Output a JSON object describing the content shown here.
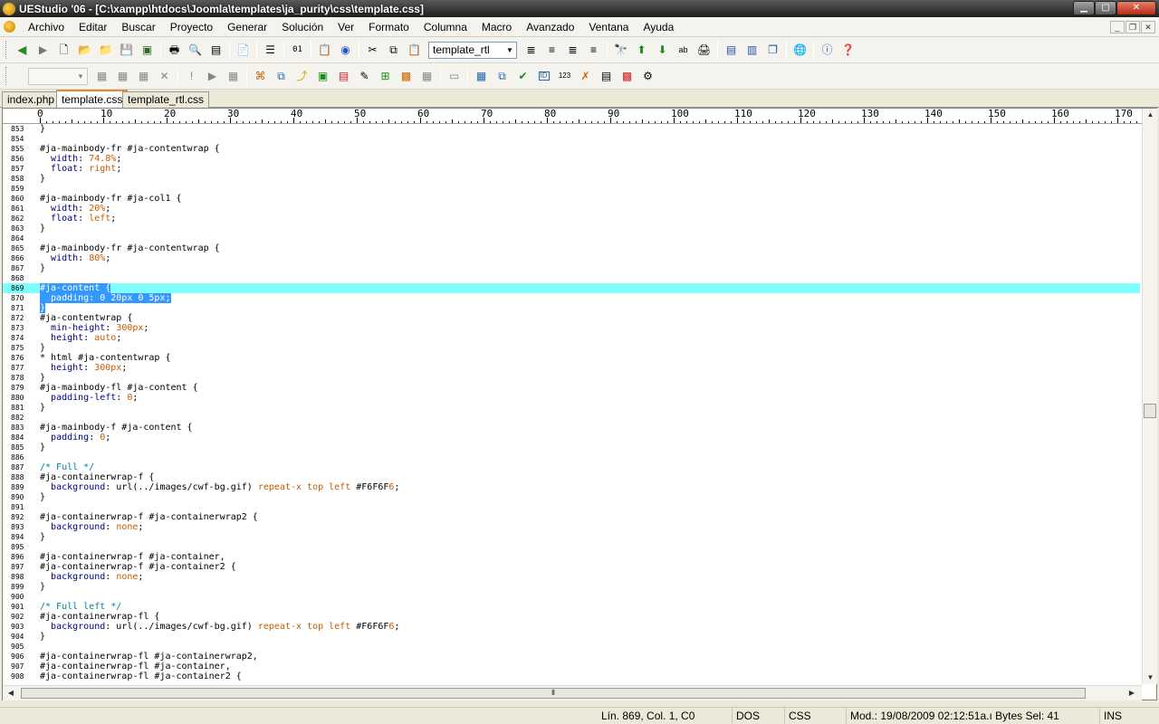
{
  "window": {
    "title": "UEStudio '06 - [C:\\xampp\\htdocs\\Joomla\\templates\\ja_purity\\css\\template.css]"
  },
  "menu": [
    "Archivo",
    "Editar",
    "Buscar",
    "Proyecto",
    "Generar",
    "Solución",
    "Ver",
    "Formato",
    "Columna",
    "Macro",
    "Avanzado",
    "Ventana",
    "Ayuda"
  ],
  "toolbar": {
    "combo_value": "template_rtl"
  },
  "tabs": [
    {
      "label": "index.php"
    },
    {
      "label": "template.css",
      "active": true
    },
    {
      "label": "template_rtl.css"
    }
  ],
  "ruler": [
    "0",
    "10",
    "20",
    "30",
    "40",
    "50",
    "60",
    "70",
    "80",
    "90",
    "100",
    "110",
    "120",
    "130",
    "140",
    "150",
    "160",
    "170"
  ],
  "code_lines": [
    {
      "n": "853",
      "t": "}"
    },
    {
      "n": "854",
      "t": ""
    },
    {
      "n": "855",
      "t": "#ja-mainbody-fr #ja-contentwrap {"
    },
    {
      "n": "856",
      "t": "  width: 74.8%;"
    },
    {
      "n": "857",
      "t": "  float: right;"
    },
    {
      "n": "858",
      "t": "}"
    },
    {
      "n": "859",
      "t": ""
    },
    {
      "n": "860",
      "t": "#ja-mainbody-fr #ja-col1 {"
    },
    {
      "n": "861",
      "t": "  width: 20%;"
    },
    {
      "n": "862",
      "t": "  float: left;"
    },
    {
      "n": "863",
      "t": "}"
    },
    {
      "n": "864",
      "t": ""
    },
    {
      "n": "865",
      "t": "#ja-mainbody-fr #ja-contentwrap {"
    },
    {
      "n": "866",
      "t": "  width: 80%;"
    },
    {
      "n": "867",
      "t": "}"
    },
    {
      "n": "868",
      "t": ""
    },
    {
      "n": "869",
      "t": "#ja-content {",
      "sel": true,
      "hl": true
    },
    {
      "n": "870",
      "t": "  padding: 0 20px 0 5px;",
      "sel": true
    },
    {
      "n": "871",
      "t": "}",
      "sel": true
    },
    {
      "n": "872",
      "t": "#ja-contentwrap {"
    },
    {
      "n": "873",
      "t": "  min-height: 300px;"
    },
    {
      "n": "874",
      "t": "  height: auto;"
    },
    {
      "n": "875",
      "t": "}"
    },
    {
      "n": "876",
      "t": "* html #ja-contentwrap {"
    },
    {
      "n": "877",
      "t": "  height: 300px;"
    },
    {
      "n": "878",
      "t": "}"
    },
    {
      "n": "879",
      "t": "#ja-mainbody-fl #ja-content {"
    },
    {
      "n": "880",
      "t": "  padding-left: 0;"
    },
    {
      "n": "881",
      "t": "}"
    },
    {
      "n": "882",
      "t": ""
    },
    {
      "n": "883",
      "t": "#ja-mainbody-f #ja-content {"
    },
    {
      "n": "884",
      "t": "  padding: 0;"
    },
    {
      "n": "885",
      "t": "}"
    },
    {
      "n": "886",
      "t": ""
    },
    {
      "n": "887",
      "t": "/* Full */"
    },
    {
      "n": "888",
      "t": "#ja-containerwrap-f {"
    },
    {
      "n": "889",
      "t": "  background: url(../images/cwf-bg.gif) repeat-x top left #F6F6F6;"
    },
    {
      "n": "890",
      "t": "}"
    },
    {
      "n": "891",
      "t": ""
    },
    {
      "n": "892",
      "t": "#ja-containerwrap-f #ja-containerwrap2 {"
    },
    {
      "n": "893",
      "t": "  background: none;"
    },
    {
      "n": "894",
      "t": "}"
    },
    {
      "n": "895",
      "t": ""
    },
    {
      "n": "896",
      "t": "#ja-containerwrap-f #ja-container,"
    },
    {
      "n": "897",
      "t": "#ja-containerwrap-f #ja-container2 {"
    },
    {
      "n": "898",
      "t": "  background: none;"
    },
    {
      "n": "899",
      "t": "}"
    },
    {
      "n": "900",
      "t": ""
    },
    {
      "n": "901",
      "t": "/* Full left */"
    },
    {
      "n": "902",
      "t": "#ja-containerwrap-fl {"
    },
    {
      "n": "903",
      "t": "  background: url(../images/cwf-bg.gif) repeat-x top left #F6F6F6;"
    },
    {
      "n": "904",
      "t": "}"
    },
    {
      "n": "905",
      "t": ""
    },
    {
      "n": "906",
      "t": "#ja-containerwrap-fl #ja-containerwrap2,"
    },
    {
      "n": "907",
      "t": "#ja-containerwrap-fl #ja-container,"
    },
    {
      "n": "908",
      "t": "#ja-containerwrap-fl #ja-container2 {"
    }
  ],
  "status": {
    "position": "Lín. 869, Col. 1, C0",
    "line_ending": "DOS",
    "syntax": "CSS",
    "modified": "Mod.: 19/08/2009 02:12:51a.ı Bytes Sel: 41",
    "mode": "INS"
  }
}
